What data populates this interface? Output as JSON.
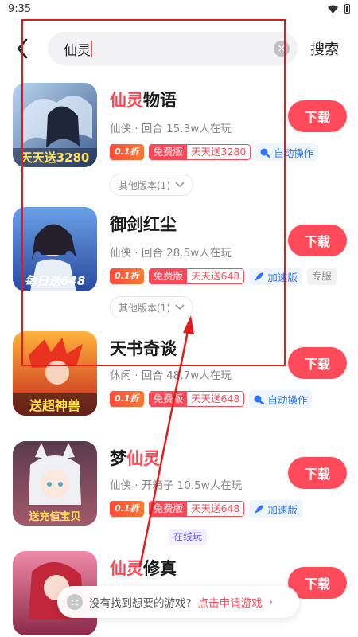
{
  "status_bar": {
    "time": "9:35"
  },
  "search": {
    "query": "仙灵",
    "placeholder": "",
    "search_label": "搜索"
  },
  "colors": {
    "accent": "#ff4a59",
    "highlight": "#ff4756",
    "feature_blue": "#2f74ff",
    "annotation": "#e21b1b"
  },
  "games": [
    {
      "title_hl": "仙灵",
      "title_rest": "物语",
      "meta": "仙侠 · 回合 15.3w人在玩",
      "discount": "0.1折",
      "free_label": "免费版",
      "gift_label": "天天送3280",
      "feature": "自动操作",
      "feature_icon": "auto-icon",
      "other_versions": "其他版本(1)",
      "cover_text": "天天送3280",
      "download": "下载"
    },
    {
      "title_plain": "御剑红尘",
      "meta": "仙侠 · 回合 28.5w人在玩",
      "discount": "0.1折",
      "free_label": "免费版",
      "gift_label": "天天送648",
      "feature": "加速版",
      "feature_icon": "rocket-icon",
      "extra_tag": "专服",
      "other_versions": "其他版本(1)",
      "cover_text": "每日送648",
      "download": "下载"
    },
    {
      "title_plain": "天书奇谈",
      "meta": "休闲 · 回合 48.7w人在玩",
      "discount": "0.1折",
      "free_label": "免费版",
      "gift_label": "天天送648",
      "feature": "自动操作",
      "feature_icon": "auto-icon",
      "cover_text": "送超神兽",
      "download": "下载"
    },
    {
      "title_pre": "梦",
      "title_hl": "仙灵",
      "online_tag": "在线玩",
      "meta": "仙侠 · 开箱子 10.5w人在玩",
      "discount": "0.1折",
      "free_label": "免费版",
      "gift_label": "天天送648",
      "feature": "加速版",
      "feature_icon": "rocket-icon",
      "cover_text": "送充值宝贝",
      "download": "下载"
    },
    {
      "title_hl": "仙灵",
      "title_rest": "修真",
      "download": "下载"
    }
  ],
  "feedback": {
    "text": "没有找到想要的游戏?",
    "link": "点击申请游戏",
    "arrow": "›"
  }
}
